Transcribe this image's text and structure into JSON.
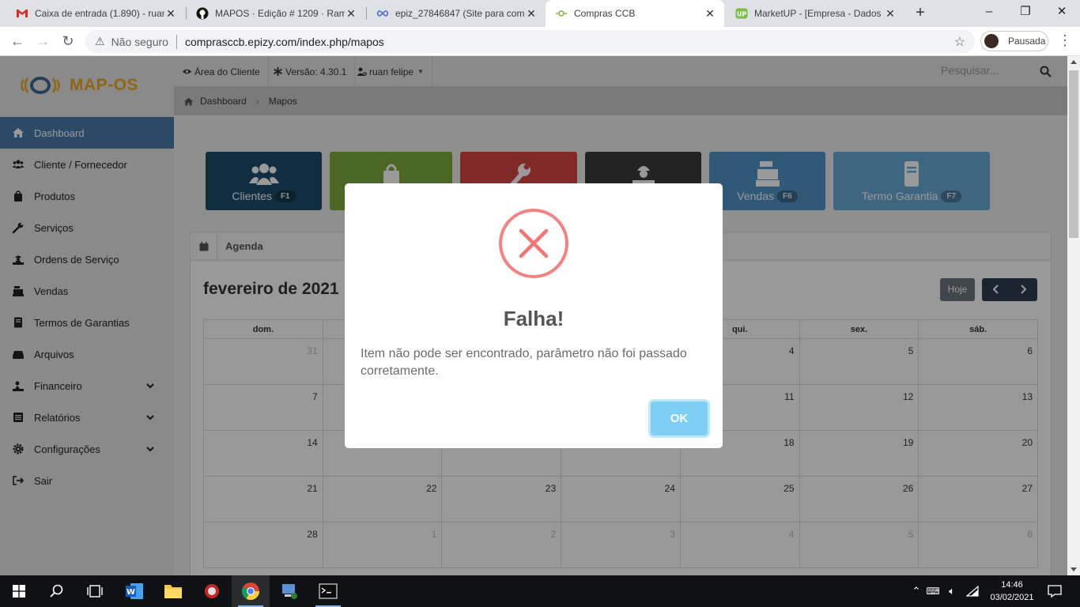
{
  "browser": {
    "tabs": [
      {
        "title": "Caixa de entrada (1.890) - ruan",
        "icon": "gmail-icon",
        "active": false
      },
      {
        "title": "MAPOS · Edição # 1209 · Ramo",
        "icon": "github-icon",
        "active": false
      },
      {
        "title": "epiz_27846847 (Site para comp",
        "icon": "infinity-icon",
        "active": false
      },
      {
        "title": "Compras CCB",
        "icon": "site-icon",
        "active": true
      },
      {
        "title": "MarketUP - [Empresa - Dados",
        "icon": "marketup-icon",
        "active": false
      }
    ],
    "security_label": "Não seguro",
    "url": "comprasccb.epizy.com/index.php/mapos",
    "profile_label": "Pausada"
  },
  "app": {
    "logo_text": "MAP-OS",
    "topbar": {
      "client_area": "Área do Cliente",
      "version": "Versão: 4.30.1",
      "user": "ruan felipe",
      "search_placeholder": "Pesquisar..."
    },
    "breadcrumb": [
      "Dashboard",
      "Mapos"
    ],
    "sidebar": [
      {
        "label": "Dashboard",
        "icon": "home-icon",
        "active": true,
        "submenu": false
      },
      {
        "label": "Cliente / Fornecedor",
        "icon": "users-icon",
        "active": false,
        "submenu": false
      },
      {
        "label": "Produtos",
        "icon": "shopping-bag-icon",
        "active": false,
        "submenu": false
      },
      {
        "label": "Serviços",
        "icon": "wrench-icon",
        "active": false,
        "submenu": false
      },
      {
        "label": "Ordens de Serviço",
        "icon": "worker-icon",
        "active": false,
        "submenu": false
      },
      {
        "label": "Vendas",
        "icon": "cash-register-icon",
        "active": false,
        "submenu": false
      },
      {
        "label": "Termos de Garantias",
        "icon": "book-icon",
        "active": false,
        "submenu": false
      },
      {
        "label": "Arquivos",
        "icon": "hdd-icon",
        "active": false,
        "submenu": false
      },
      {
        "label": "Financeiro",
        "icon": "money-icon",
        "active": false,
        "submenu": true
      },
      {
        "label": "Relatórios",
        "icon": "list-icon",
        "active": false,
        "submenu": true
      },
      {
        "label": "Configurações",
        "icon": "gear-icon",
        "active": false,
        "submenu": true
      },
      {
        "label": "Sair",
        "icon": "sign-out-icon",
        "active": false,
        "submenu": false
      }
    ],
    "quick_buttons": [
      {
        "label": "Clientes",
        "key": "F1",
        "color": "#1d4e6b",
        "icon": "users-icon"
      },
      {
        "label": "",
        "key": "",
        "color": "#7cad3a",
        "icon": "shopping-bag-icon"
      },
      {
        "label": "",
        "key": "",
        "color": "#d54541",
        "icon": "wrench-icon"
      },
      {
        "label": "",
        "key": "",
        "color": "#3b3b3b",
        "icon": "worker-icon"
      },
      {
        "label": "Vendas",
        "key": "F6",
        "color": "#4f94c6",
        "icon": "cash-register-icon"
      },
      {
        "label": "Termo Garantia",
        "key": "F7",
        "color": "#6aaad8",
        "icon": "book-icon"
      }
    ],
    "agenda": {
      "title": "Agenda",
      "month": "fevereiro de 2021",
      "today_label": "Hoje",
      "weekdays": [
        "dom.",
        "",
        "",
        "",
        "qui.",
        "sex.",
        "sáb."
      ],
      "weeks": [
        [
          {
            "d": "31",
            "o": true
          },
          {
            "d": "",
            "o": false
          },
          {
            "d": "",
            "o": false
          },
          {
            "d": "",
            "o": false
          },
          {
            "d": "4",
            "o": false
          },
          {
            "d": "5",
            "o": false
          },
          {
            "d": "6",
            "o": false
          }
        ],
        [
          {
            "d": "7",
            "o": false
          },
          {
            "d": "",
            "o": false
          },
          {
            "d": "",
            "o": false
          },
          {
            "d": "",
            "o": false
          },
          {
            "d": "11",
            "o": false
          },
          {
            "d": "12",
            "o": false
          },
          {
            "d": "13",
            "o": false
          }
        ],
        [
          {
            "d": "14",
            "o": false
          },
          {
            "d": "",
            "o": false
          },
          {
            "d": "",
            "o": false
          },
          {
            "d": "",
            "o": false
          },
          {
            "d": "18",
            "o": false
          },
          {
            "d": "19",
            "o": false
          },
          {
            "d": "20",
            "o": false
          }
        ],
        [
          {
            "d": "21",
            "o": false
          },
          {
            "d": "22",
            "o": false
          },
          {
            "d": "23",
            "o": false
          },
          {
            "d": "24",
            "o": false
          },
          {
            "d": "25",
            "o": false
          },
          {
            "d": "26",
            "o": false
          },
          {
            "d": "27",
            "o": false
          }
        ],
        [
          {
            "d": "28",
            "o": false
          },
          {
            "d": "1",
            "o": true
          },
          {
            "d": "2",
            "o": true
          },
          {
            "d": "3",
            "o": true
          },
          {
            "d": "4",
            "o": true
          },
          {
            "d": "5",
            "o": true
          },
          {
            "d": "6",
            "o": true
          }
        ]
      ]
    }
  },
  "modal": {
    "title": "Falha!",
    "text": "Item não pode ser encontrado, parâmetro não foi passado corretamente.",
    "ok_label": "OK",
    "icon": "error-x-icon"
  },
  "taskbar": {
    "time": "14:46",
    "date": "03/02/2021"
  },
  "colors": {
    "accent": "#4a7cab",
    "error": "#f27474",
    "ok_button": "#7ecff4"
  }
}
